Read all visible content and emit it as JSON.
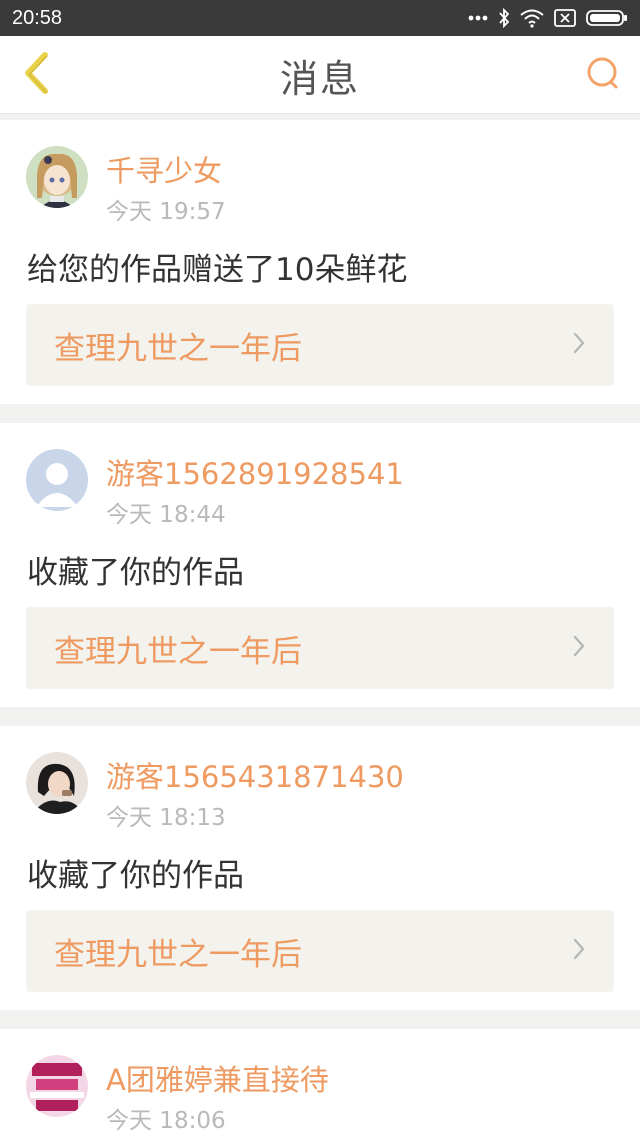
{
  "status_bar": {
    "time": "20:58",
    "icons": [
      "more-dots-icon",
      "bluetooth-icon",
      "wifi-icon",
      "sim-icon",
      "battery-icon"
    ]
  },
  "header": {
    "title": "消息",
    "back_icon": "back-arrow-icon",
    "search_icon": "search-icon"
  },
  "colors": {
    "accent": "#ee9a61",
    "back_icon": "#e8d24a",
    "search_icon": "#f4a36a"
  },
  "messages": [
    {
      "name": "千寻少女",
      "time": "今天 19:57",
      "text": "给您的作品赠送了10朵鲜花",
      "work": "查理九世之一年后",
      "avatar": "anime-girl-avatar"
    },
    {
      "name": "游客1562891928541",
      "time": "今天 18:44",
      "text": "收藏了你的作品",
      "work": "查理九世之一年后",
      "avatar": "default-user-avatar"
    },
    {
      "name": "游客1565431871430",
      "time": "今天 18:13",
      "text": "收藏了你的作品",
      "work": "查理九世之一年后",
      "avatar": "photo-girl-avatar"
    },
    {
      "name": "A团雅婷兼直接待",
      "time": "今天 18:06",
      "avatar": "recruitment-ad-avatar"
    }
  ]
}
